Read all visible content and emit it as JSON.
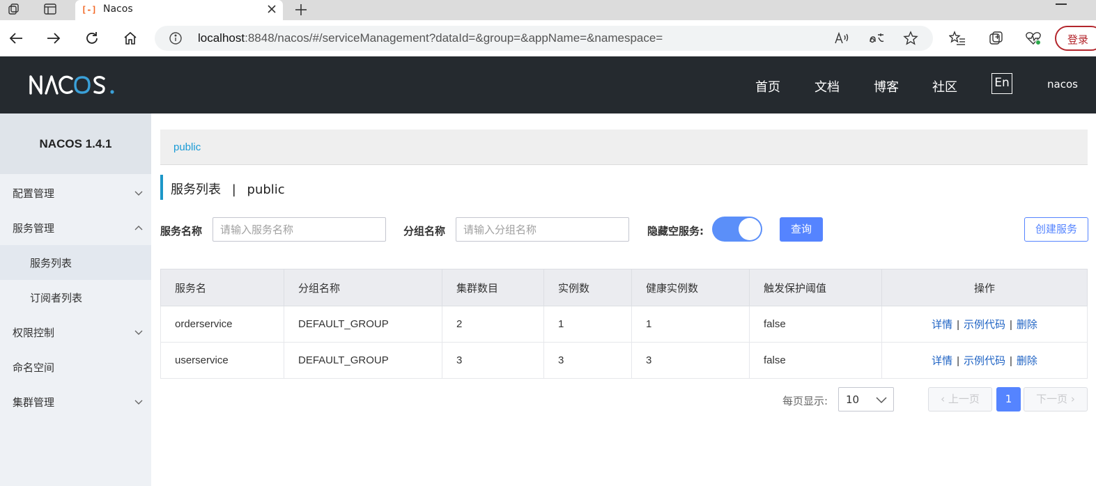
{
  "browser": {
    "tab_title": "Nacos",
    "url_host": "localhost",
    "url_rest": ":8848/nacos/#/serviceManagement?dataId=&group=&appName=&namespace=",
    "login_label": "登录",
    "tab_logo_glyph": "[-]"
  },
  "header": {
    "nav": [
      "首页",
      "文档",
      "博客",
      "社区"
    ],
    "lang_button": "En",
    "user": "nacos"
  },
  "sidebar": {
    "version": "NACOS 1.4.1",
    "items": [
      {
        "label": "配置管理",
        "expandable": true,
        "expanded": false
      },
      {
        "label": "服务管理",
        "expandable": true,
        "expanded": true
      },
      {
        "label": "服务列表",
        "sub": true,
        "active": true
      },
      {
        "label": "订阅者列表",
        "sub": true
      },
      {
        "label": "权限控制",
        "expandable": true,
        "expanded": false
      },
      {
        "label": "命名空间"
      },
      {
        "label": "集群管理",
        "expandable": true,
        "expanded": false
      }
    ]
  },
  "main": {
    "namespace_tab": "public",
    "title": "服务列表",
    "title_sep": "|",
    "title_ns": "public",
    "filters": {
      "service_name_label": "服务名称",
      "service_name_placeholder": "请输入服务名称",
      "group_name_label": "分组名称",
      "group_name_placeholder": "请输入分组名称",
      "hide_empty_label": "隐藏空服务:",
      "hide_empty_on": true,
      "query_button": "查询",
      "create_button": "创建服务"
    },
    "table": {
      "columns": [
        "服务名",
        "分组名称",
        "集群数目",
        "实例数",
        "健康实例数",
        "触发保护阈值",
        "操作"
      ],
      "rows": [
        {
          "name": "orderservice",
          "group": "DEFAULT_GROUP",
          "clusters": "2",
          "instances": "1",
          "healthy": "1",
          "threshold": "false"
        },
        {
          "name": "userservice",
          "group": "DEFAULT_GROUP",
          "clusters": "3",
          "instances": "3",
          "healthy": "3",
          "threshold": "false"
        }
      ],
      "actions": {
        "detail": "详情",
        "sample_code": "示例代码",
        "delete": "删除",
        "sep": "|"
      }
    },
    "pagination": {
      "per_page_label": "每页显示:",
      "per_page": "10",
      "prev": "上一页",
      "next": "下一页",
      "current": "1"
    }
  },
  "colors": {
    "header_bg": "#252a2f",
    "primary": "#5584ff",
    "link": "#1f63c4",
    "accent": "#1d97c8"
  }
}
